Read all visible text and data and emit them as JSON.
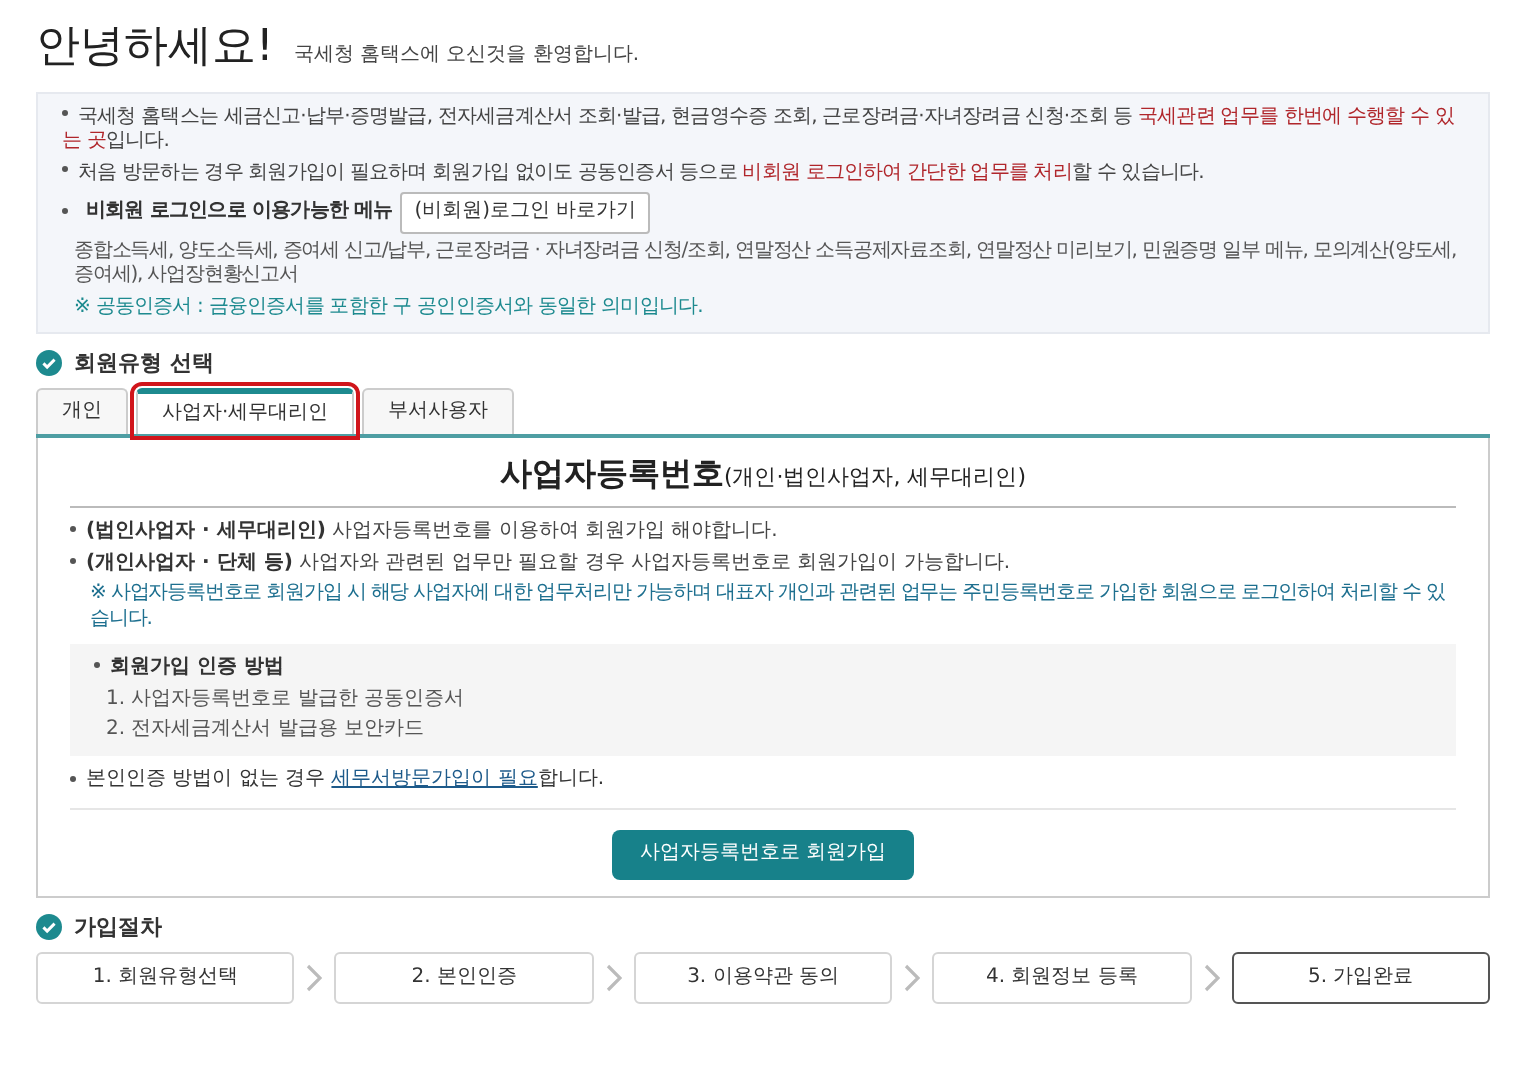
{
  "greeting": {
    "title": "안녕하세요!",
    "subtitle": "국세청 홈택스에 오신것을 환영합니다."
  },
  "notice": {
    "lines": [
      "국세청 홈택스는 세금신고·납부·증명발급, 전자세금계산서 조회·발급, 현금영수증 조회, 근로장려금·자녀장려금 신청·조회 등 **국세관련 업무를 한번에 수행할 수 있는 곳**입니다.",
      "처음 방문하는 경우 회원가입이 필요하며 회원가입 없이도 공동인증서 등으로 **비회원 로그인하여 간단한 업무를 처리**할 수 있습니다."
    ],
    "guest_label": "비회원 로그인으로 이용가능한 메뉴",
    "guest_button": "(비회원)로그인 바로가기",
    "guest_menu": "종합소득세, 양도소득세, 증여세 신고/납부, 근로장려금 · 자녀장려금 신청/조회, 연말정산 소득공제자료조회, 연말정산 미리보기, 민원증명 일부 메뉴, 모의계산(양도세,증여세), 사업장현황신고서",
    "cert_note": "※ 공동인증서 : 금융인증서를 포함한 구 공인인증서와 동일한 의미입니다."
  },
  "member_type": {
    "heading": "회원유형 선택",
    "tabs": [
      {
        "label": "개인",
        "selected": false
      },
      {
        "label": "사업자·세무대리인",
        "selected": true
      },
      {
        "label": "부서사용자",
        "selected": false
      }
    ]
  },
  "panel": {
    "title": "사업자등록번호",
    "title_suffix": "(개인·법인사업자, 세무대리인)",
    "notes": [
      "**(법인사업자 · 세무대리인)** 사업자등록번호를 이용하여 회원가입 해야합니다.",
      "**(개인사업자 · 단체 등)** 사업자와 관련된 업무만 필요할 경우 사업자등록번호로 회원가입이 가능합니다."
    ],
    "warning": "※ 사업자등록번호로 회원가입 시 해당 사업자에 대한 업무처리만 가능하며 대표자 개인과 관련된 업무는 주민등록번호로 가입한 회원으로 로그인하여 처리할 수 있습니다.",
    "auth": {
      "heading": "회원가입 인증 방법",
      "methods": [
        "1. 사업자등록번호로 발급한 공동인증서",
        "2. 전자세금계산서 발급용 보안카드"
      ]
    },
    "visit": {
      "prefix": "본인인증 방법이 없는 경우 ",
      "link": "세무서방문가입이 필요",
      "suffix": "합니다."
    },
    "button": "사업자등록번호로 회원가입"
  },
  "procedure": {
    "heading": "가입절차",
    "steps": [
      {
        "label": "1. 회원유형선택",
        "selected": false
      },
      {
        "label": "2. 본인인증",
        "selected": false
      },
      {
        "label": "3. 이용약관 동의",
        "selected": false
      },
      {
        "label": "4. 회원정보 등록",
        "selected": false
      },
      {
        "label": "5. 가입완료",
        "selected": true
      }
    ]
  }
}
